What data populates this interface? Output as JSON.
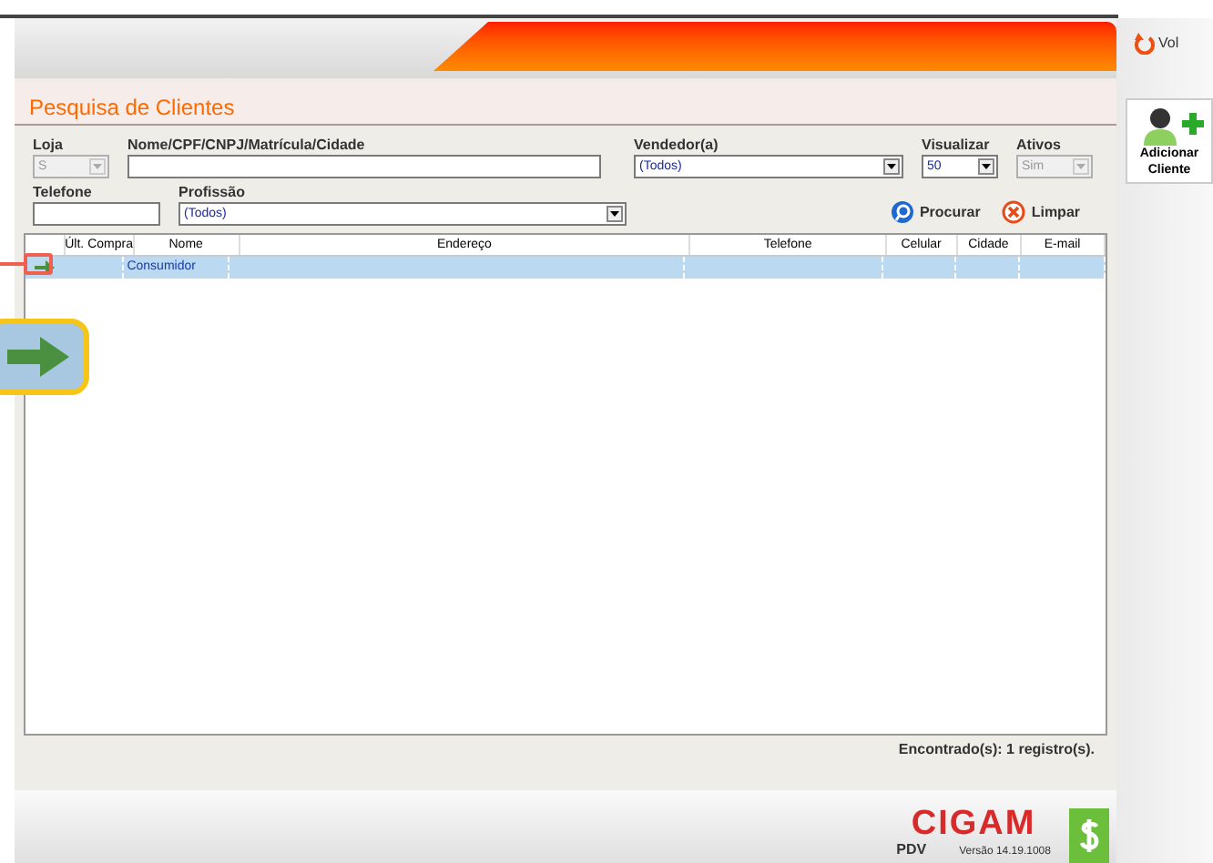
{
  "page_title": "Pesquisa de Clientes",
  "filters_row1": [
    {
      "kind": "select",
      "label": "Loja",
      "value": "S",
      "disabled": true
    },
    {
      "kind": "text",
      "label": "Nome/CPF/CNPJ/Matrícula/Cidade"
    },
    {
      "kind": "select",
      "label": "Vendedor(a)",
      "value": "(Todos)",
      "disabled": false
    },
    {
      "kind": "select",
      "label": "Visualizar",
      "value": "50",
      "disabled": false
    },
    {
      "kind": "select",
      "label": "Ativos",
      "value": "Sim",
      "disabled": true
    }
  ],
  "filters_row2": [
    {
      "kind": "text",
      "label": "Telefone"
    },
    {
      "kind": "select",
      "label": "Profissão",
      "value": "(Todos)",
      "disabled": false
    }
  ],
  "actions": [
    {
      "kind": "search",
      "label": "Procurar"
    },
    {
      "kind": "clear",
      "label": "Limpar"
    }
  ],
  "table": {
    "columns": [
      "Últ. Compra",
      "Nome",
      "Endereço",
      "Telefone",
      "Celular",
      "Cidade",
      "E-mail"
    ],
    "rows": [
      {
        "selected": true,
        "cells": [
          "",
          "Consumidor",
          "",
          "",
          "",
          "",
          ""
        ]
      }
    ]
  },
  "result_count": "Encontrado(s): 1 registro(s).",
  "footer": {
    "logo": "CIGAM",
    "product": "PDV",
    "version": "Versão 14.19.1008"
  },
  "sidebar": {
    "back_label": "Vol",
    "add_label": "Adicionar Cliente"
  }
}
